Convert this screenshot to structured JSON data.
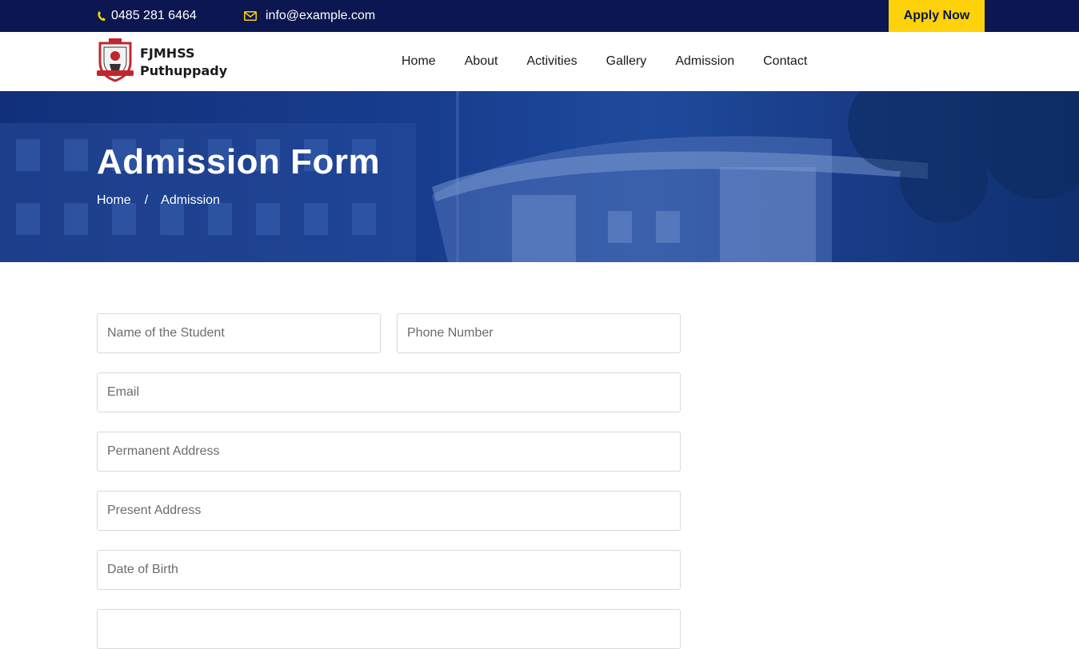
{
  "topbar": {
    "phone": "0485 281 6464",
    "email": "info@example.com",
    "apply_label": "Apply Now",
    "icons": {
      "phone": "phone-icon",
      "email": "envelope-icon"
    },
    "colors": {
      "background": "#0c1650",
      "accent": "#fdd20a"
    }
  },
  "navbar": {
    "logo_line1": "FJMHSS",
    "logo_line2": "Puthuppady",
    "links": [
      "Home",
      "About",
      "Activities",
      "Gallery",
      "Admission",
      "Contact"
    ]
  },
  "hero": {
    "title": "Admission Form",
    "breadcrumb": {
      "home": "Home",
      "separator": "/",
      "current": "Admission"
    }
  },
  "form": {
    "student_name": {
      "placeholder": "Name of the Student",
      "value": ""
    },
    "phone": {
      "placeholder": "Phone Number",
      "value": ""
    },
    "email": {
      "placeholder": "Email",
      "value": ""
    },
    "permanent_address": {
      "placeholder": "Permanent Address",
      "value": ""
    },
    "present_address": {
      "placeholder": "Present Address",
      "value": ""
    },
    "dob": {
      "placeholder": "Date of Birth",
      "value": ""
    }
  }
}
